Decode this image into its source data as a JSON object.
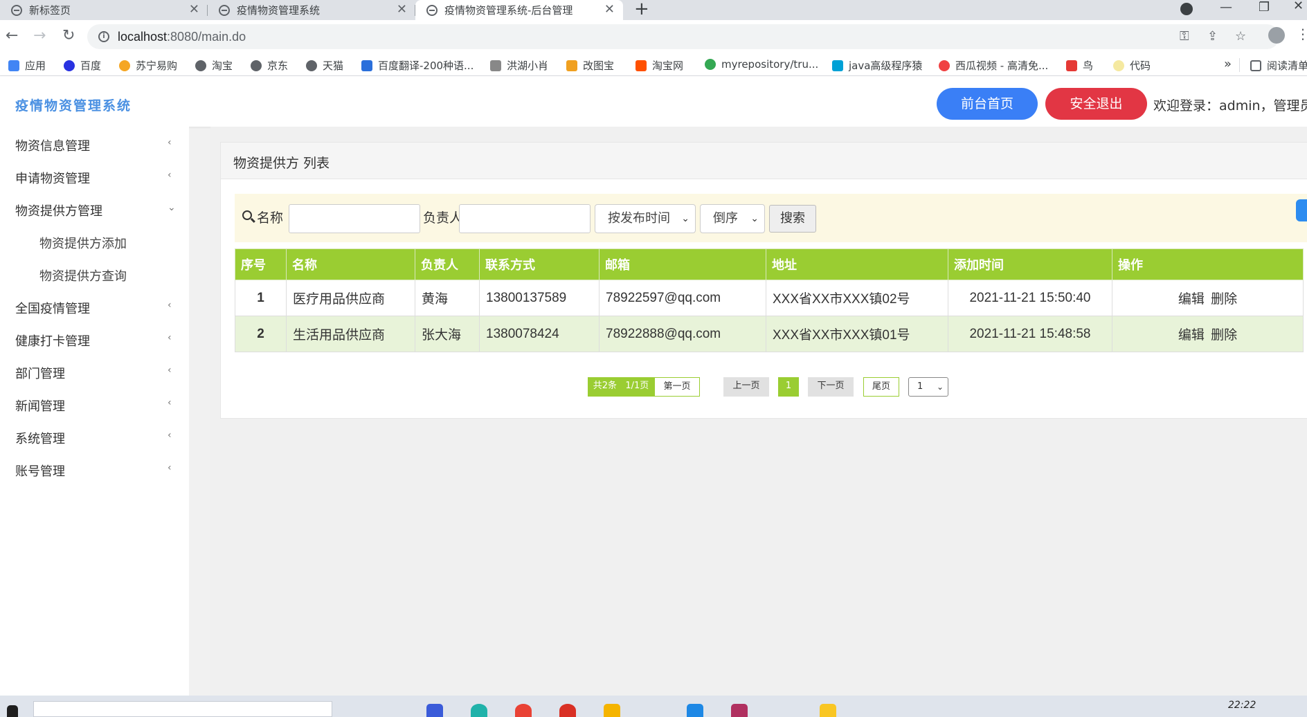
{
  "browser": {
    "tabs": [
      {
        "title": "新标签页"
      },
      {
        "title": "疫情物资管理系统"
      },
      {
        "title": "疫情物资管理系统-后台管理"
      }
    ],
    "url_host": "localhost",
    "url_path": ":8080/main.do",
    "bookmarks": [
      {
        "label": "应用",
        "color": "#4285f4"
      },
      {
        "label": "百度",
        "color": "#2932e1"
      },
      {
        "label": "苏宁易购",
        "color": "#f5a623"
      },
      {
        "label": "淘宝",
        "color": "#5f6368"
      },
      {
        "label": "京东",
        "color": "#5f6368"
      },
      {
        "label": "天猫",
        "color": "#5f6368"
      },
      {
        "label": "百度翻译-200种语...",
        "color": "#2a6fdb"
      },
      {
        "label": "洪湖小肖",
        "color": "#888888"
      },
      {
        "label": "改图宝",
        "color": "#f0a020"
      },
      {
        "label": "淘宝网",
        "color": "#ff5000"
      },
      {
        "label": "myrepository/tru...",
        "color": "#34a853"
      },
      {
        "label": "java高级程序猿",
        "color": "#00a1d6"
      },
      {
        "label": "西瓜视频 - 高清免...",
        "color": "#f04142"
      },
      {
        "label": "鸟",
        "color": "#e53935"
      },
      {
        "label": "代码",
        "color": "#f5e9a0"
      }
    ],
    "reading_list": "阅读清单"
  },
  "header": {
    "brand": "疫情物资管理系统",
    "home_button": "前台首页",
    "logout_button": "安全退出",
    "welcome": "欢迎登录：admin，管理员"
  },
  "sidebar": {
    "items": [
      {
        "label": "物资信息管理",
        "chevron": "‹"
      },
      {
        "label": "申请物资管理",
        "chevron": "‹"
      },
      {
        "label": "物资提供方管理",
        "chevron": "⌄"
      },
      {
        "label": "物资提供方添加"
      },
      {
        "label": "物资提供方查询"
      },
      {
        "label": "全国疫情管理",
        "chevron": "‹"
      },
      {
        "label": "健康打卡管理",
        "chevron": "‹"
      },
      {
        "label": "部门管理",
        "chevron": "‹"
      },
      {
        "label": "新闻管理",
        "chevron": "‹"
      },
      {
        "label": "系统管理",
        "chevron": "‹"
      },
      {
        "label": "账号管理",
        "chevron": "‹"
      }
    ]
  },
  "panel": {
    "title": "物资提供方 列表"
  },
  "search": {
    "name_label": "名称",
    "name_value": "",
    "person_label": "负责人",
    "person_value": "",
    "sort_field": "按发布时间",
    "sort_order": "倒序",
    "button": "搜索"
  },
  "table": {
    "headers": [
      "序号",
      "名称",
      "负责人",
      "联系方式",
      "邮箱",
      "地址",
      "添加时间",
      "操作"
    ],
    "rows": [
      {
        "idx": "1",
        "name": "医疗用品供应商",
        "person": "黄海",
        "phone": "13800137589",
        "email": "78922597@qq.com",
        "address": "XXX省XX市XXX镇02号",
        "time": "2021-11-21 15:50:40",
        "edit": "编辑",
        "del": "删除"
      },
      {
        "idx": "2",
        "name": "生活用品供应商",
        "person": "张大海",
        "phone": "1380078424",
        "email": "78922888@qq.com",
        "address": "XXX省XX市XXX镇01号",
        "time": "2021-11-21 15:48:58",
        "edit": "编辑",
        "del": "删除"
      }
    ]
  },
  "pager": {
    "total": "共2条",
    "pages": "1/1页",
    "first": "第一页",
    "prev": "上一页",
    "current": "1",
    "next": "下一页",
    "last": "尾页",
    "jump": "1"
  },
  "taskbar": {
    "time": "22:22"
  },
  "colors": {
    "accent_green": "#9acd32",
    "brand_blue": "#4a90e2",
    "home_blue": "#3a7ff6",
    "logout_red": "#e23644"
  }
}
